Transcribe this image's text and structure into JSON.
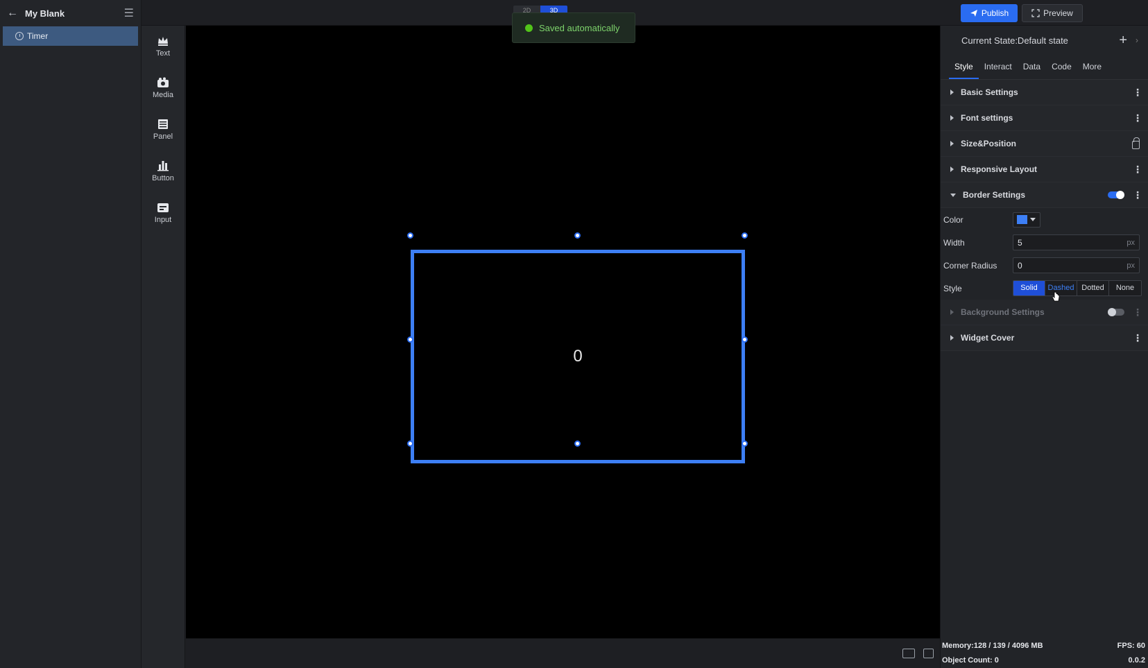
{
  "project": {
    "title": "My Blank"
  },
  "outline": {
    "items": [
      {
        "label": "Timer"
      }
    ]
  },
  "toolbar": {
    "tools": [
      {
        "label": "Text",
        "icon": "crown-icon"
      },
      {
        "label": "Media",
        "icon": "camera-icon"
      },
      {
        "label": "Panel",
        "icon": "panel-icon"
      },
      {
        "label": "Button",
        "icon": "bar-chart-icon"
      },
      {
        "label": "Input",
        "icon": "input-icon"
      }
    ]
  },
  "topbar": {
    "mode_2d": "2D",
    "mode_3d": "3D",
    "publish_label": "Publish",
    "preview_label": "Preview"
  },
  "toast": {
    "message": "Saved automatically"
  },
  "canvas": {
    "timer_value": "0",
    "border_color": "#3d7ff5"
  },
  "right_panel": {
    "state_label": "Current State:Default state",
    "tabs": [
      "Style",
      "Interact",
      "Data",
      "Code",
      "More"
    ],
    "active_tab": "Style",
    "sections": {
      "basic": "Basic Settings",
      "font": "Font settings",
      "size_position": "Size&Position",
      "responsive": "Responsive Layout",
      "border": "Border Settings",
      "background": "Background Settings",
      "cover": "Widget Cover"
    },
    "border": {
      "color_label": "Color",
      "color_value": "#3d7ff5",
      "width_label": "Width",
      "width_value": "5",
      "width_unit": "px",
      "radius_label": "Corner Radius",
      "radius_value": "0",
      "radius_unit": "px",
      "style_label": "Style",
      "style_options": [
        "Solid",
        "Dashed",
        "Dotted",
        "None"
      ],
      "style_selected": "Solid",
      "enabled": true
    },
    "background_enabled": false
  },
  "status": {
    "memory": "Memory:128 / 139 / 4096 MB",
    "fps": "FPS: 60",
    "object_count": "Object Count: 0",
    "version": "0.0.2"
  },
  "colors": {
    "accent": "#2a6cf1",
    "toast_text": "#7dd36b",
    "selection": "#3d5a80"
  }
}
